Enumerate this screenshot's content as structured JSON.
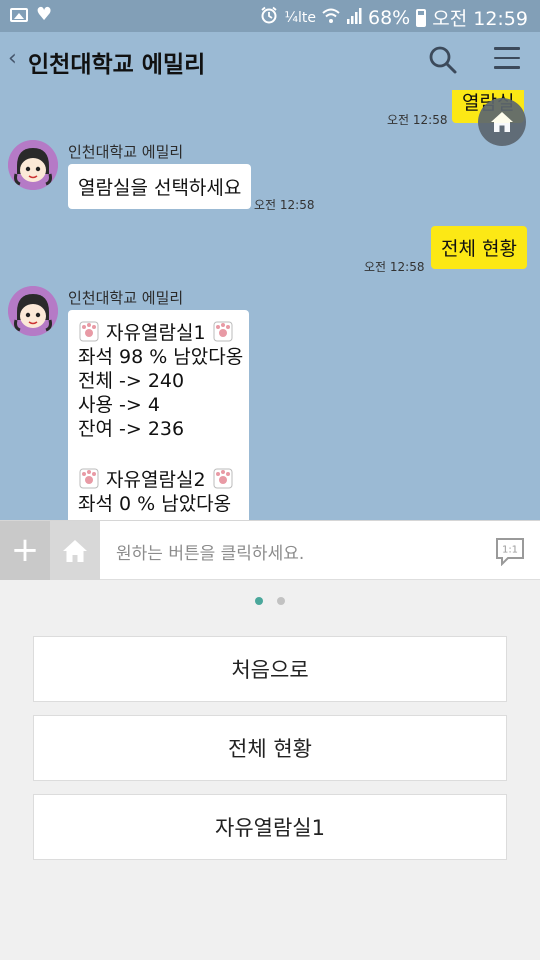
{
  "status_bar": {
    "network_label": "¼lte",
    "battery": "68%",
    "time": "오전 12:59"
  },
  "header": {
    "back_glyph": "‹",
    "title": "인천대학교 에밀리"
  },
  "chat": {
    "messages": [
      {
        "from": "me",
        "text": "열람실",
        "time": "오전 12:58"
      },
      {
        "from": "bot",
        "sender": "인천대학교 에밀리",
        "text": "열람실을 선택하세요",
        "time": "오전 12:58"
      },
      {
        "from": "me",
        "text": "전체 현황",
        "time": "오전 12:58"
      },
      {
        "from": "bot",
        "sender": "인천대학교 에밀리",
        "room1": {
          "name": "자유열람실1",
          "lines": [
            "좌석 98 % 남았다옹",
            "전체 -> 240",
            "사용 -> 4",
            "잔여 -> 236"
          ]
        },
        "room2": {
          "name": "자유열람실2",
          "lines": [
            "좌석 0 % 남았다옹"
          ]
        }
      }
    ]
  },
  "input": {
    "plus_glyph": "+",
    "placeholder": "원하는 버튼을 클릭하세요.",
    "mode_label": "1:1"
  },
  "pager": {
    "pages": 2,
    "active": 0
  },
  "quick_replies": [
    "처음으로",
    "전체 현황",
    "자유열람실1"
  ],
  "colors": {
    "chat_bg": "#9bbad4",
    "my_bubble": "#fce815",
    "bot_bubble": "#ffffff",
    "status_bar": "#829fb7",
    "pager_active": "#4aa79b"
  }
}
